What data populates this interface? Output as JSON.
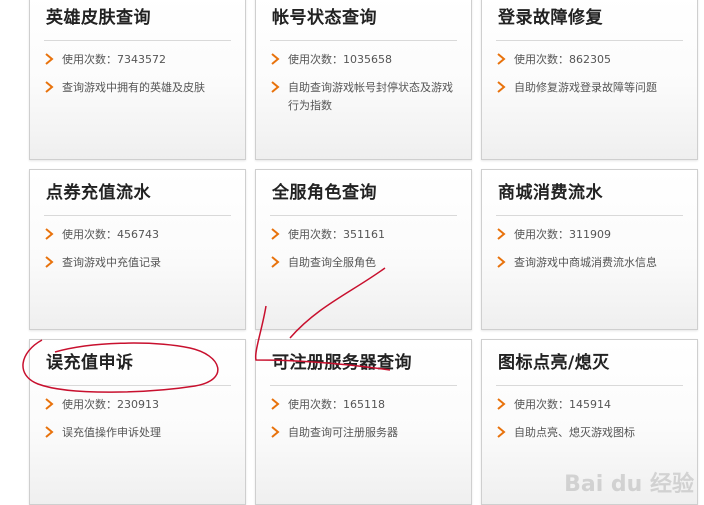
{
  "cards": [
    {
      "title": "英雄皮肤查询",
      "usage": "使用次数：7343572",
      "desc": "查询游戏中拥有的英雄及皮肤"
    },
    {
      "title": "帐号状态查询",
      "usage": "使用次数：1035658",
      "desc": "自助查询游戏帐号封停状态及游戏行为指数"
    },
    {
      "title": "登录故障修复",
      "usage": "使用次数：862305",
      "desc": "自助修复游戏登录故障等问题"
    },
    {
      "title": "点券充值流水",
      "usage": "使用次数：456743",
      "desc": "查询游戏中充值记录"
    },
    {
      "title": "全服角色查询",
      "usage": "使用次数：351161",
      "desc": "自助查询全服角色"
    },
    {
      "title": "商城消费流水",
      "usage": "使用次数：311909",
      "desc": "查询游戏中商城消费流水信息"
    },
    {
      "title": "误充值申诉",
      "usage": "使用次数：230913",
      "desc": "误充值操作申诉处理"
    },
    {
      "title": "可注册服务器查询",
      "usage": "使用次数：165118",
      "desc": "自助查询可注册服务器"
    },
    {
      "title": "图标点亮/熄灭",
      "usage": "使用次数：145914",
      "desc": "自助点亮、熄灭游戏图标"
    }
  ],
  "watermark": "Bai du 经验",
  "colors": {
    "accent": "#e8720c",
    "annotation": "#c8102e"
  }
}
